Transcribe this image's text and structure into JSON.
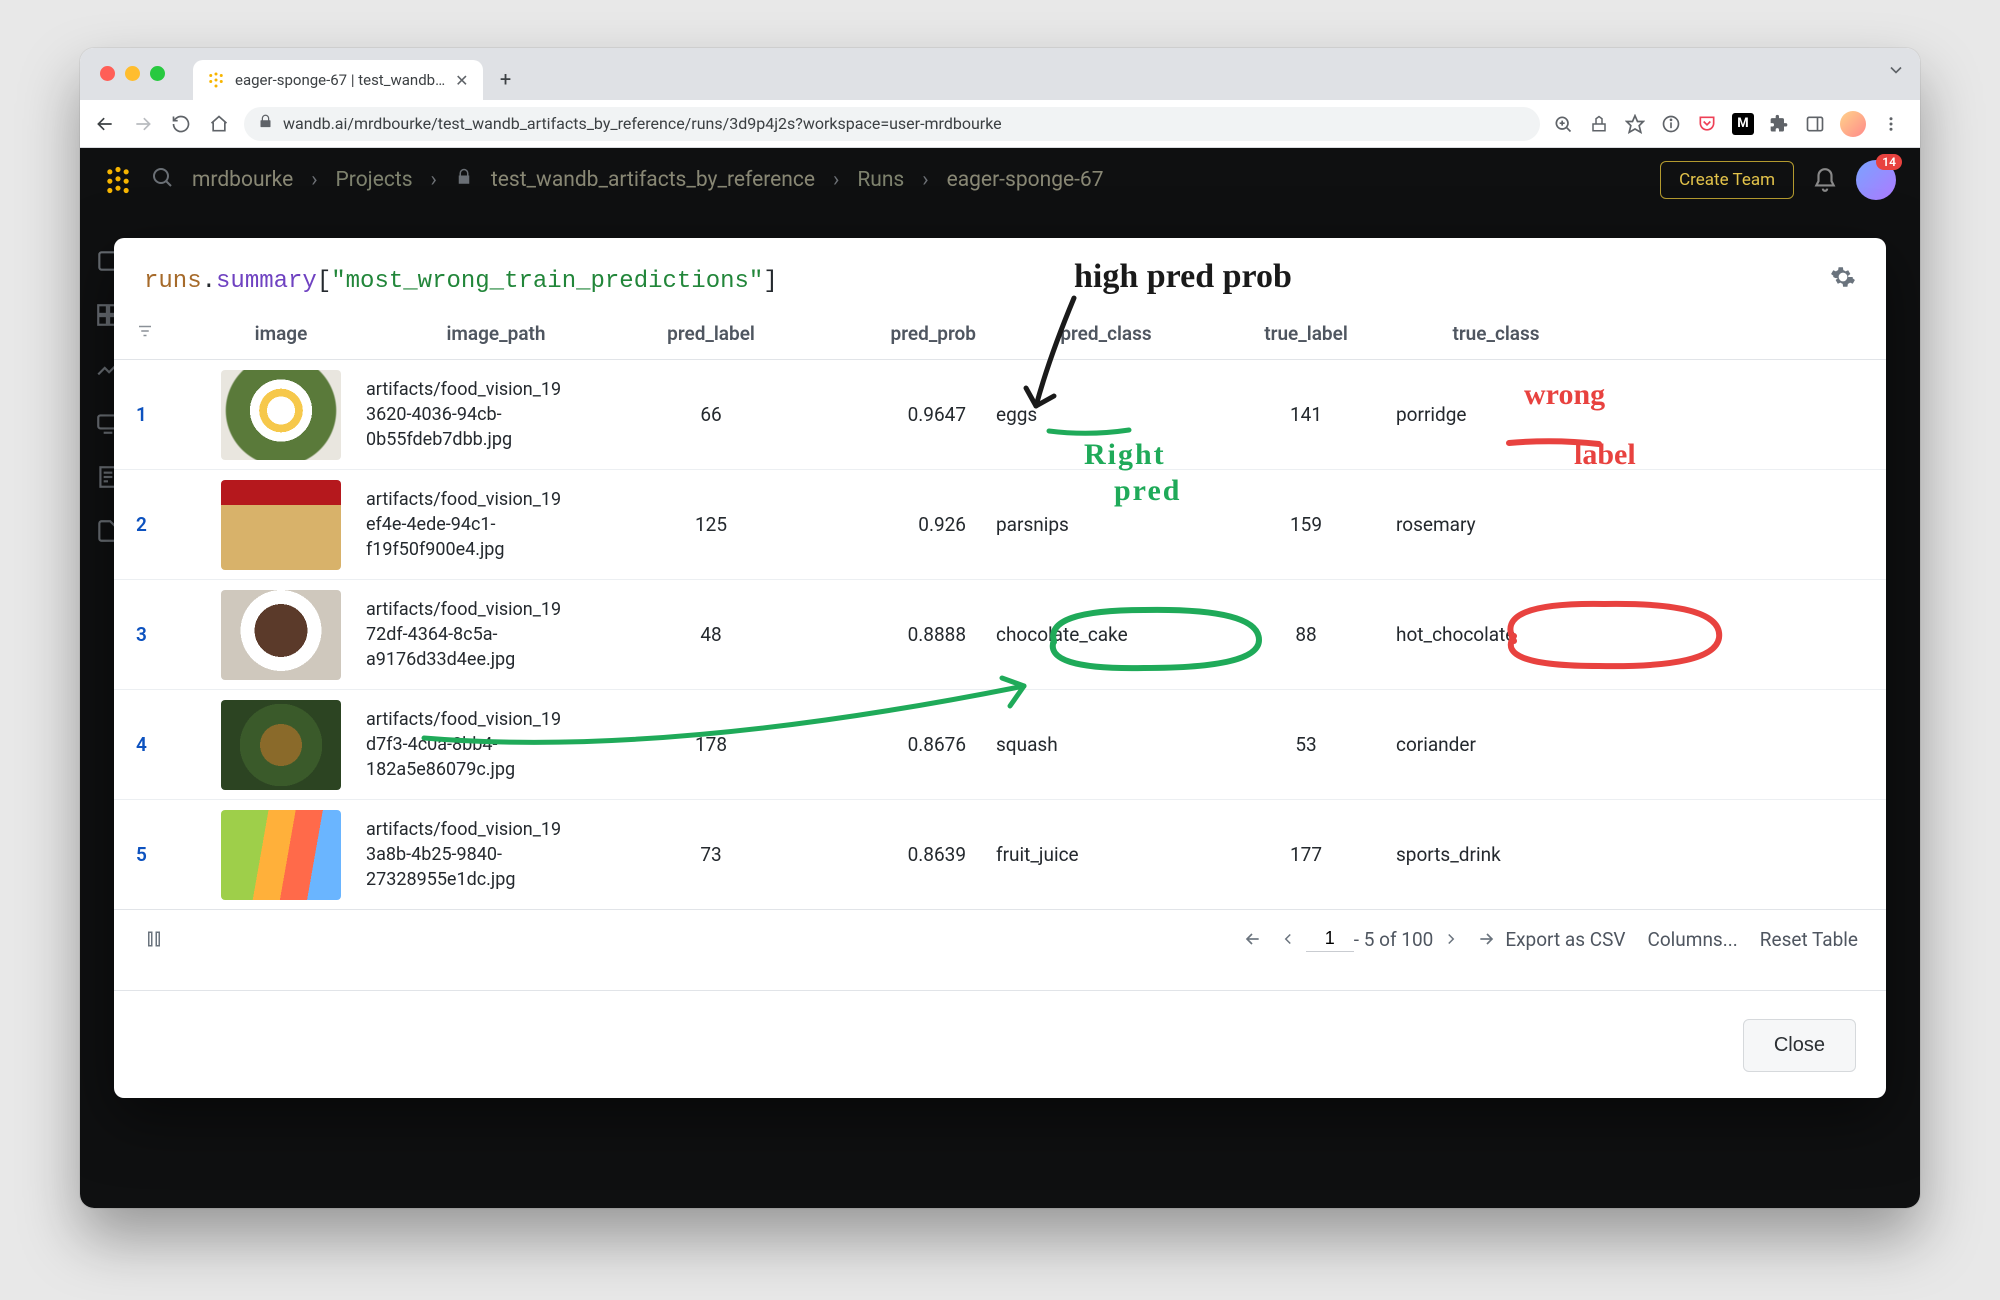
{
  "browser": {
    "tab_title": "eager-sponge-67 | test_wandb…",
    "url": "wandb.ai/mrdbourke/test_wandb_artifacts_by_reference/runs/3d9p4j2s?workspace=user-mrdbourke"
  },
  "app": {
    "breadcrumbs": [
      "mrdbourke",
      "Projects",
      "test_wandb_artifacts_by_reference",
      "Runs",
      "eager-sponge-67"
    ],
    "create_team": "Create Team",
    "notif_count": "14"
  },
  "title_parts": {
    "a": "runs",
    "b": ".",
    "c": "summary",
    "d": "[",
    "e": "\"most_wrong_train_predictions\"",
    "f": "]"
  },
  "columns": [
    "image",
    "image_path",
    "pred_label",
    "pred_prob",
    "pred_class",
    "true_label",
    "true_class"
  ],
  "rows": [
    {
      "idx": "1",
      "path_l1": "artifacts/food_vision_19",
      "path_l2": "3620-4036-94cb-",
      "path_l3": "0b55fdeb7dbb.jpg",
      "pred_label": "66",
      "pred_prob": "0.9647",
      "pred_class": "eggs",
      "true_label": "141",
      "true_class": "porridge"
    },
    {
      "idx": "2",
      "path_l1": "artifacts/food_vision_19",
      "path_l2": "ef4e-4ede-94c1-",
      "path_l3": "f19f50f900e4.jpg",
      "pred_label": "125",
      "pred_prob": "0.926",
      "pred_class": "parsnips",
      "true_label": "159",
      "true_class": "rosemary"
    },
    {
      "idx": "3",
      "path_l1": "artifacts/food_vision_19",
      "path_l2": "72df-4364-8c5a-",
      "path_l3": "a9176d33d4ee.jpg",
      "pred_label": "48",
      "pred_prob": "0.8888",
      "pred_class": "chocolate_cake",
      "true_label": "88",
      "true_class": "hot_chocolate"
    },
    {
      "idx": "4",
      "path_l1": "artifacts/food_vision_19",
      "path_l2": "d7f3-4c0a-8bb4-",
      "path_l3": "182a5e86079c.jpg",
      "pred_label": "178",
      "pred_prob": "0.8676",
      "pred_class": "squash",
      "true_label": "53",
      "true_class": "coriander"
    },
    {
      "idx": "5",
      "path_l1": "artifacts/food_vision_19",
      "path_l2": "3a8b-4b25-9840-",
      "path_l3": "27328955e1dc.jpg",
      "pred_label": "73",
      "pred_prob": "0.8639",
      "pred_class": "fruit_juice",
      "true_label": "177",
      "true_class": "sports_drink"
    }
  ],
  "pager": {
    "page": "1",
    "range": " - 5 of 100",
    "export": "Export as CSV",
    "columns": "Columns...",
    "reset": "Reset Table"
  },
  "close": "Close",
  "annotations": {
    "high_pred": "high pred prob",
    "right_pred_1": "Right",
    "right_pred_2": "pred",
    "wrong_1": "wrong",
    "wrong_2": "label"
  }
}
